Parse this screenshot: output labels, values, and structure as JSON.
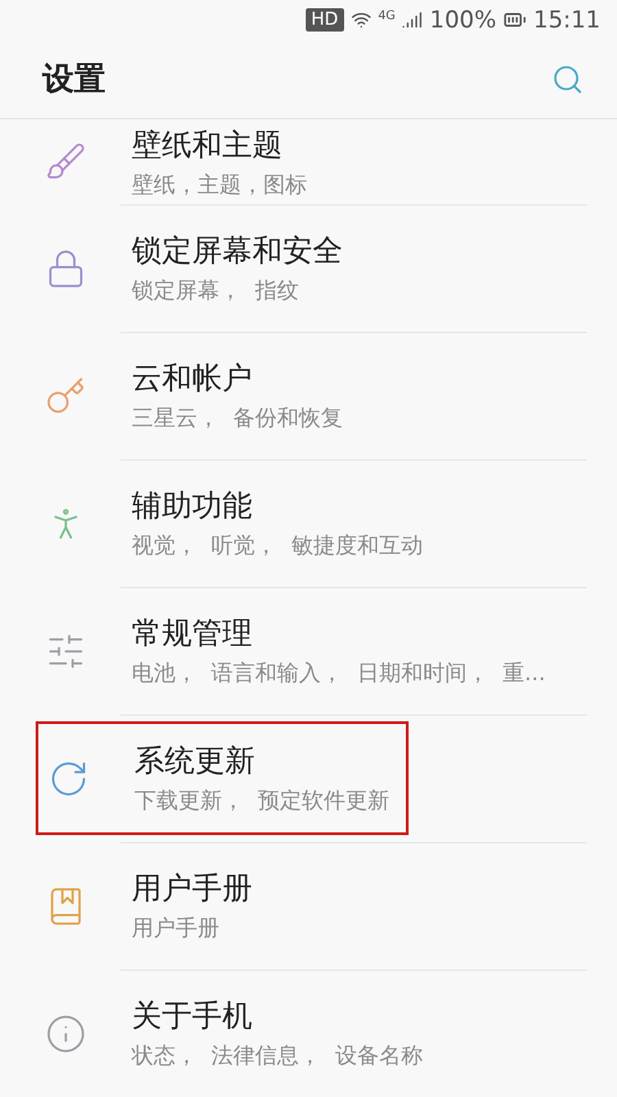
{
  "status_bar": {
    "hd": "HD",
    "network": "4G",
    "battery": "100%",
    "time": "15:11"
  },
  "header": {
    "title": "设置"
  },
  "items": [
    {
      "kind": "brush",
      "color": "#b58ad0",
      "title": "壁纸和主题",
      "subtitle": "壁纸，主题，图标",
      "highlighted": false
    },
    {
      "kind": "lock",
      "color": "#9a8fd0",
      "title": "锁定屏幕和安全",
      "subtitle": "锁定屏幕，  指纹",
      "highlighted": false
    },
    {
      "kind": "key",
      "color": "#e8a070",
      "title": "云和帐户",
      "subtitle": "三星云，  备份和恢复",
      "highlighted": false
    },
    {
      "kind": "person",
      "color": "#7cc08a",
      "title": "辅助功能",
      "subtitle": "视觉，  听觉，  敏捷度和互动",
      "highlighted": false
    },
    {
      "kind": "sliders",
      "color": "#9aa0a6",
      "title": "常规管理",
      "subtitle": "电池，  语言和输入，  日期和时间，  重...",
      "highlighted": false
    },
    {
      "kind": "update",
      "color": "#5b9bd5",
      "title": "系统更新",
      "subtitle": "下载更新，  预定软件更新",
      "highlighted": true
    },
    {
      "kind": "book",
      "color": "#e0a24a",
      "title": "用户手册",
      "subtitle": "用户手册",
      "highlighted": false
    },
    {
      "kind": "info",
      "color": "#9aa0a6",
      "title": "关于手机",
      "subtitle": "状态，  法律信息，  设备名称",
      "highlighted": false
    }
  ]
}
